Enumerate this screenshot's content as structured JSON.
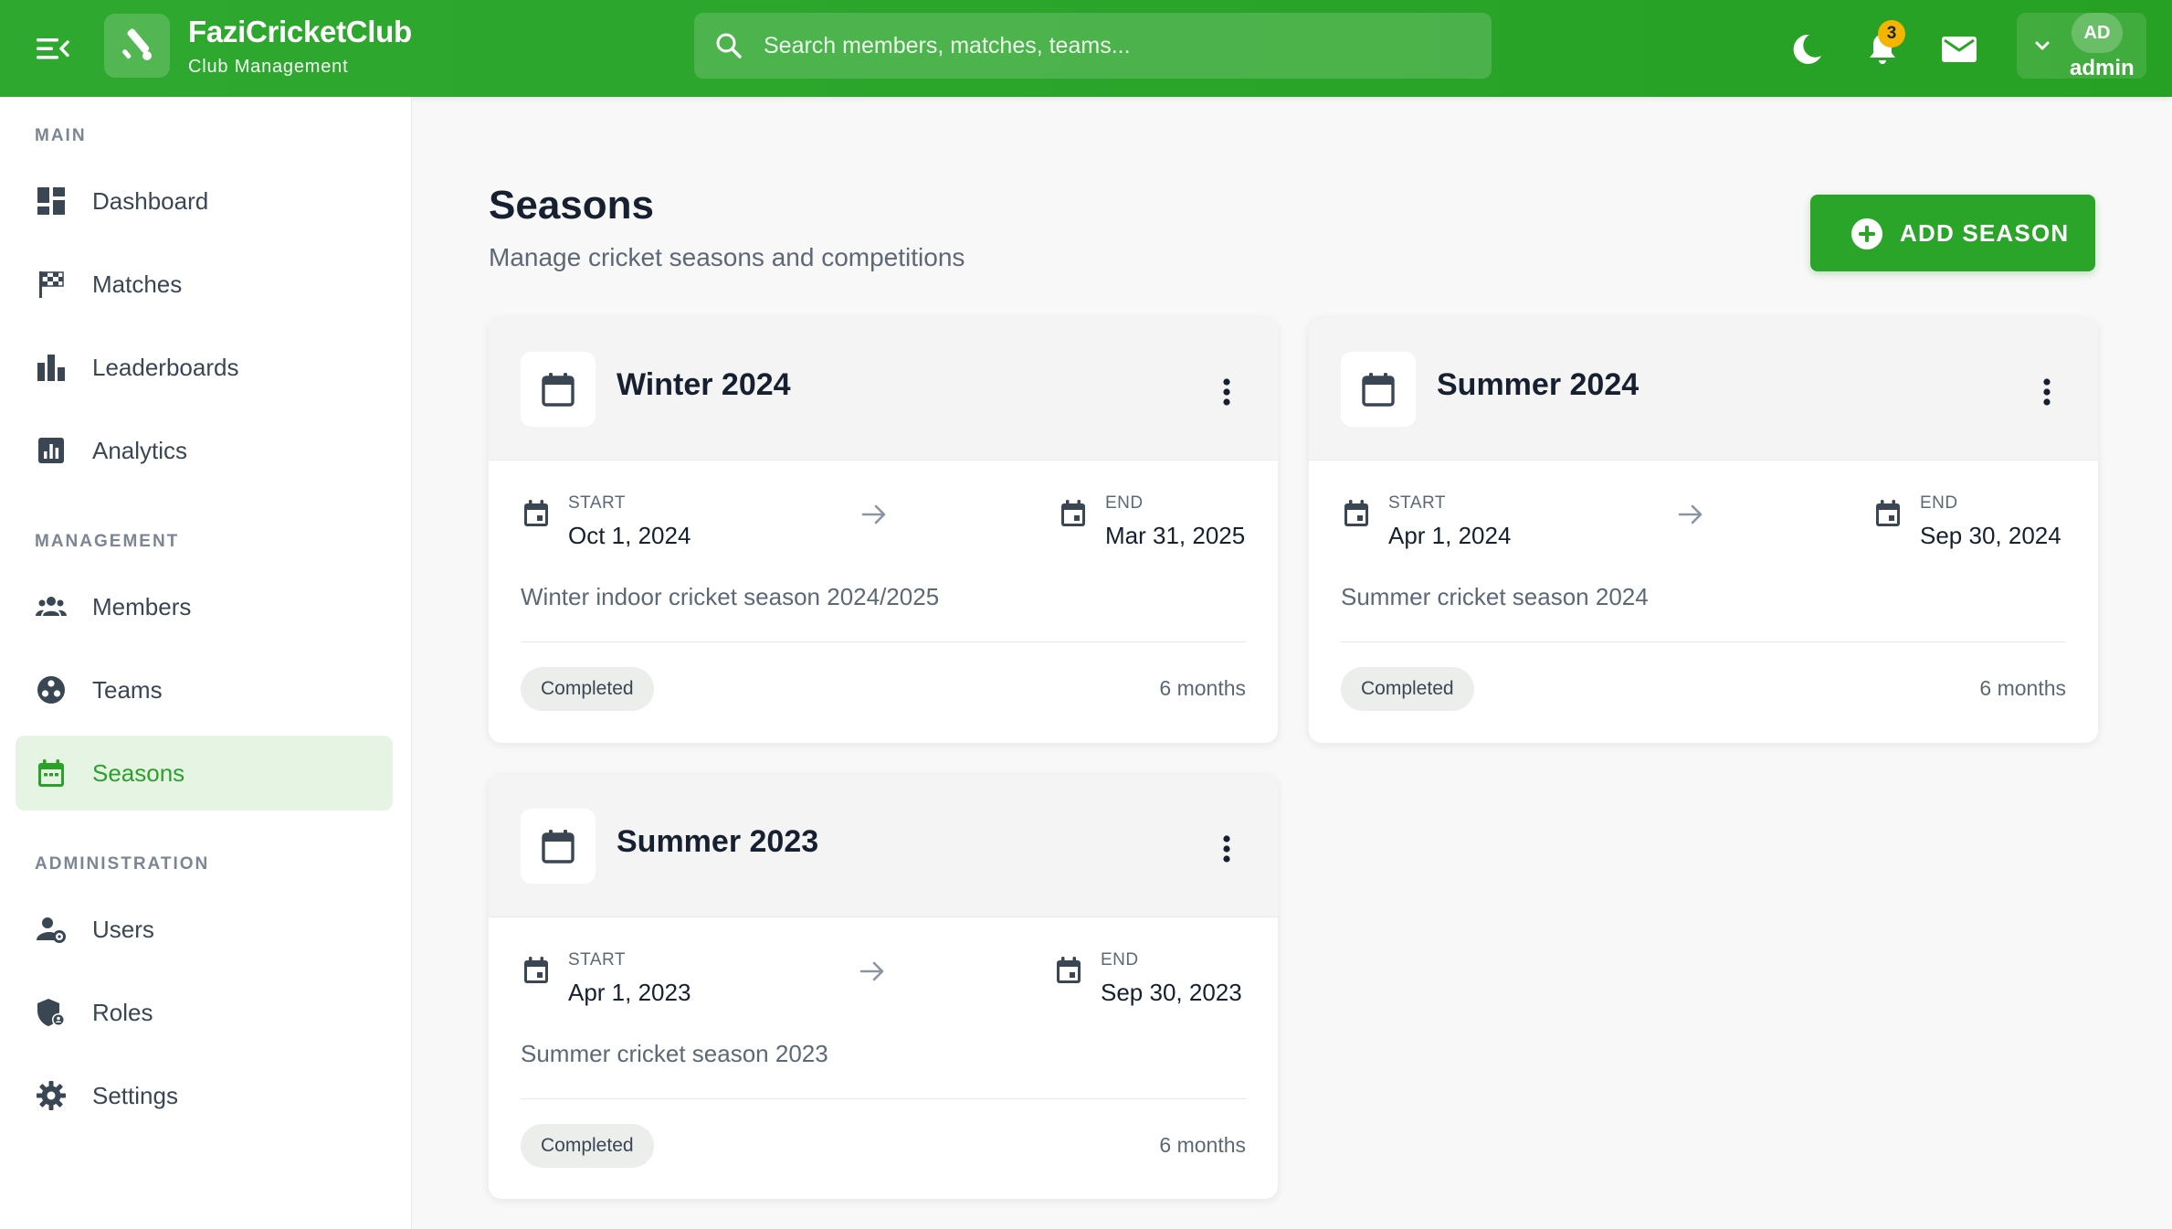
{
  "header": {
    "brand_name": "FaziCricketClub",
    "brand_subtitle": "Club Management",
    "search_placeholder": "Search members, matches, teams...",
    "notification_count": "3",
    "avatar_initials": "AD",
    "username": "admin",
    "accent_color": "#2ba52a"
  },
  "sidebar": {
    "sections": [
      {
        "title": "MAIN",
        "items": [
          {
            "label": "Dashboard",
            "icon": "dashboard-icon"
          },
          {
            "label": "Matches",
            "icon": "checkered-flag-icon"
          },
          {
            "label": "Leaderboards",
            "icon": "bar-chart-icon"
          },
          {
            "label": "Analytics",
            "icon": "analytics-icon"
          }
        ]
      },
      {
        "title": "MANAGEMENT",
        "items": [
          {
            "label": "Members",
            "icon": "group-icon"
          },
          {
            "label": "Teams",
            "icon": "teams-icon"
          },
          {
            "label": "Seasons",
            "icon": "calendar-icon",
            "active": true
          }
        ]
      },
      {
        "title": "ADMINISTRATION",
        "items": [
          {
            "label": "Users",
            "icon": "user-settings-icon"
          },
          {
            "label": "Roles",
            "icon": "shield-user-icon"
          },
          {
            "label": "Settings",
            "icon": "gear-icon"
          }
        ]
      }
    ]
  },
  "main": {
    "title": "Seasons",
    "subtitle": "Manage cricket seasons and competitions",
    "add_button_label": "ADD SEASON",
    "start_label": "START",
    "end_label": "END",
    "seasons": [
      {
        "name": "Winter 2024",
        "start": "Oct 1, 2024",
        "end": "Mar 31, 2025",
        "description": "Winter indoor cricket season 2024/2025",
        "status": "Completed",
        "duration": "6 months"
      },
      {
        "name": "Summer 2024",
        "start": "Apr 1, 2024",
        "end": "Sep 30, 2024",
        "description": "Summer cricket season 2024",
        "status": "Completed",
        "duration": "6 months"
      },
      {
        "name": "Summer 2023",
        "start": "Apr 1, 2023",
        "end": "Sep 30, 2023",
        "description": "Summer cricket season 2023",
        "status": "Completed",
        "duration": "6 months"
      }
    ]
  }
}
